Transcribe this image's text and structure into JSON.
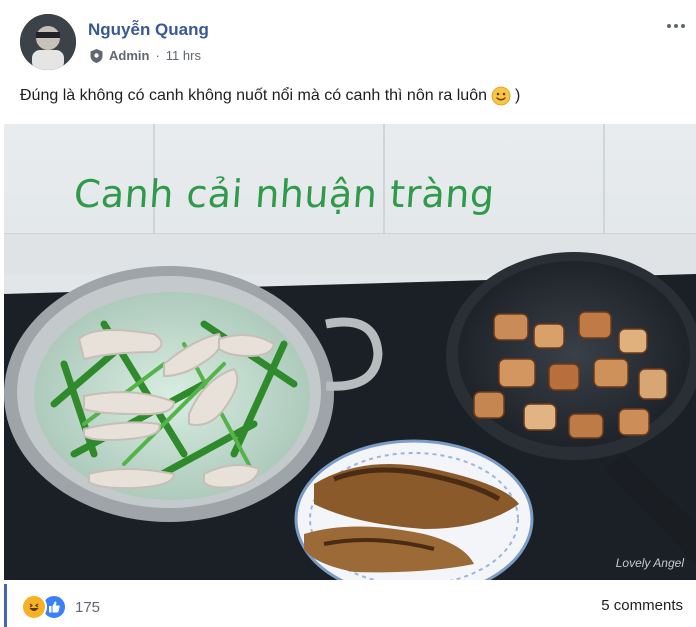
{
  "post": {
    "author": "Nguyễn Quang",
    "role": "Admin",
    "time": "11 hrs",
    "text": "Đúng là không có canh không nuốt nổi mà có canh thì nôn ra luôn",
    "text_tail": ")"
  },
  "photo": {
    "caption": "Canh cải nhuận tràng",
    "watermark": "Lovely Angel"
  },
  "footer": {
    "reaction_count": "175",
    "comments": "5 comments"
  },
  "icons": {
    "more": "more-options-icon",
    "role": "shield-icon",
    "emoji": "smile-emoji",
    "reactions": [
      "haha-icon",
      "like-icon"
    ]
  },
  "colors": {
    "author": "#385898",
    "caption": "#2e9a4a",
    "like": "#3a80f6",
    "haha": "#f7b125"
  }
}
